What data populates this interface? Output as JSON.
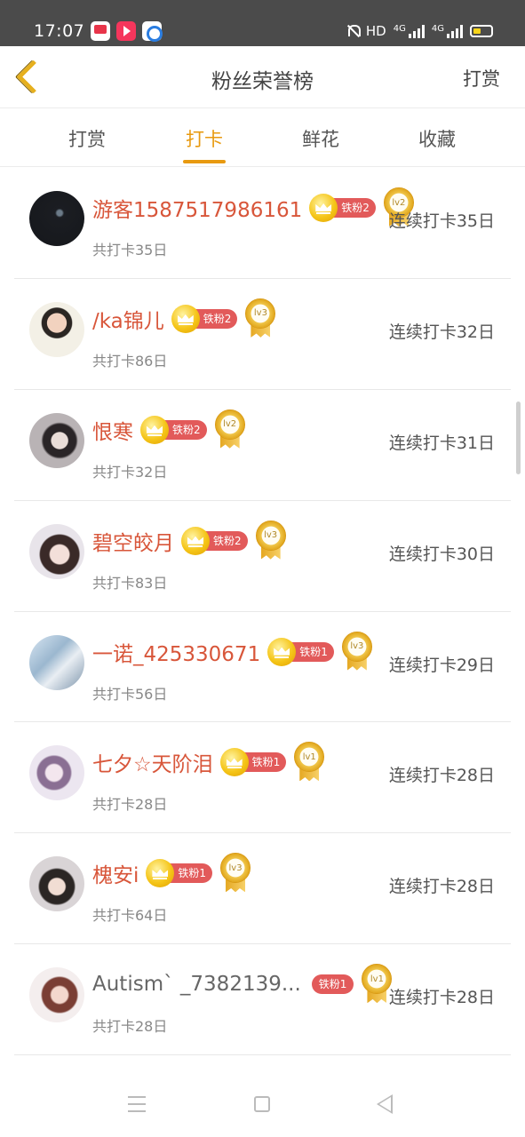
{
  "status_bar": {
    "time": "17:07",
    "hd": "HD",
    "net1": "4G",
    "net2": "4G"
  },
  "header": {
    "title": "粉丝荣誉榜",
    "right_action": "打赏"
  },
  "tabs": [
    {
      "label": "打赏"
    },
    {
      "label": "打卡",
      "active": true
    },
    {
      "label": "鲜花"
    },
    {
      "label": "收藏"
    }
  ],
  "rows": [
    {
      "name": "游客1587517986161",
      "fan_badge": "铁粉2",
      "level": "lv2",
      "total": "共打卡35日",
      "streak": "连续打卡35日"
    },
    {
      "name": "/ka锦儿",
      "fan_badge": "铁粉2",
      "level": "lv3",
      "total": "共打卡86日",
      "streak": "连续打卡32日"
    },
    {
      "name": "恨寒",
      "fan_badge": "铁粉2",
      "level": "lv2",
      "total": "共打卡32日",
      "streak": "连续打卡31日"
    },
    {
      "name": "碧空皎月",
      "fan_badge": "铁粉2",
      "level": "lv3",
      "total": "共打卡83日",
      "streak": "连续打卡30日"
    },
    {
      "name": "一诺_425330671",
      "fan_badge": "铁粉1",
      "level": "lv3",
      "total": "共打卡56日",
      "streak": "连续打卡29日"
    },
    {
      "name": "七夕☆天阶泪",
      "fan_badge": "铁粉1",
      "level": "lv1",
      "total": "共打卡28日",
      "streak": "连续打卡28日"
    },
    {
      "name": "槐安i",
      "fan_badge": "铁粉1",
      "level": "lv3",
      "total": "共打卡64日",
      "streak": "连续打卡28日"
    },
    {
      "name": "Autism`  _7382139...",
      "fan_badge": "铁粉1",
      "level": "lv1",
      "total": "共打卡28日",
      "streak": "连续打卡28日"
    }
  ],
  "colors": {
    "accent": "#e89a10",
    "name_red": "#d8563a",
    "fan_pill": "#e25a5a",
    "status_bar": "#4b4b4b"
  }
}
